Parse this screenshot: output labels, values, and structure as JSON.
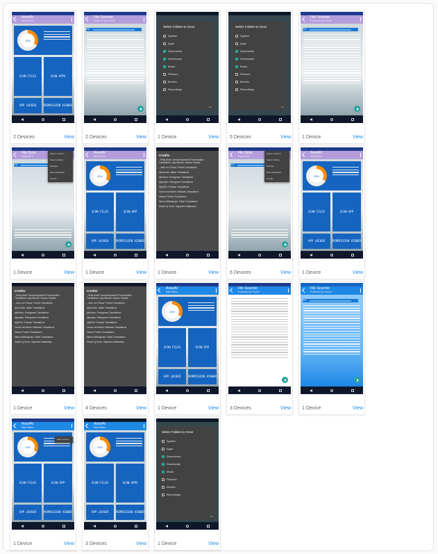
{
  "devices": [
    {
      "kind": "main",
      "count": "2 Devices",
      "view": "View",
      "title": "AssoAV",
      "subtitle": "Main Menu",
      "pct": "33%",
      "btn1": "SCAN FILES",
      "btn2": "SCAN APPS",
      "btn3": "APP LOCKER",
      "btn4": "PERMISSION VIEWER"
    },
    {
      "kind": "scanner",
      "count": "2 Devices",
      "view": "View",
      "title": "File Scanner",
      "subtitle": "Powered by Foxxire",
      "pct": "0%"
    },
    {
      "kind": "folders",
      "count": "1 Device",
      "view": "View"
    },
    {
      "kind": "folders-dim",
      "count": "5 Devices",
      "view": "View"
    },
    {
      "kind": "scanner",
      "count": "1 Device",
      "view": "View",
      "title": "File Scanner",
      "subtitle": "Powered by Foxxire",
      "pct": "0%"
    },
    {
      "kind": "scanner-menu",
      "count": "1 Device",
      "view": "View",
      "title": "File Scan",
      "subtitle": "Powered b",
      "pct": "0%"
    },
    {
      "kind": "main",
      "count": "1 Device",
      "view": "View",
      "title": "AssoAV",
      "subtitle": "Main Menu",
      "pct": "33%",
      "btn1": "SCAN FILES",
      "btn2": "SCAN APP",
      "btn3": "APP LOCKER",
      "btn4": "PERMISSION VIEWER"
    },
    {
      "kind": "credits",
      "count": "1 Device",
      "view": "View"
    },
    {
      "kind": "scanner-menu",
      "count": "6 Devices",
      "view": "View",
      "title": "File Scan",
      "subtitle": "Powered b",
      "pct": "0%"
    },
    {
      "kind": "main",
      "count": "1 Device",
      "view": "View",
      "title": "AssoAV",
      "subtitle": "Main Menu",
      "pct": "33%",
      "btn1": "SCAN FILES",
      "btn2": "SCAN APP",
      "btn3": "APP LOCKER",
      "btn4": "PERMISSION VIEWER"
    },
    {
      "kind": "credits",
      "count": "1 Device",
      "view": "View"
    },
    {
      "kind": "credits",
      "count": "4 Devices",
      "view": "View"
    },
    {
      "kind": "main-blue",
      "count": "1 Device",
      "view": "View",
      "title": "AssoAV",
      "subtitle": "Main Menu",
      "pct": "33%",
      "btn1": "SCAN FILES",
      "btn2": "SCAN APP",
      "btn3": "APP LOCKER",
      "btn4": "PERMISSION VIEWER"
    },
    {
      "kind": "scanner-white",
      "count": "3 Devices",
      "view": "View",
      "title": "File Scanner",
      "subtitle": "Powered by Foxxire",
      "pct": ""
    },
    {
      "kind": "scanner-blue",
      "count": "1 Device",
      "view": "View",
      "title": "File Scanner",
      "subtitle": "Powered by Foxxire",
      "pct": "0%"
    },
    {
      "kind": "main-menu",
      "count": "1 Device",
      "view": "View",
      "title": "AssoAV",
      "subtitle": "Main Menu",
      "pct": "33%",
      "btn1": "SCAN FILES",
      "btn2": "SCAN APP",
      "btn3": "APP LOCKER",
      "btn4": "PERMISSION VIEWER"
    },
    {
      "kind": "main-dark",
      "count": "3 Devices",
      "view": "View",
      "title": "AssoAV",
      "subtitle": "Main Menu",
      "pct": "33%",
      "btn1": "SCAN FILES",
      "btn2": "SCAN APPS",
      "btn3": "APP LOCKER",
      "btn4": "PERMISSION VIEWER"
    },
    {
      "kind": "folders-full",
      "count": "1 Device",
      "view": "View"
    }
  ],
  "folders": {
    "title": "Select Folders to Scan",
    "items": [
      {
        "label": "System",
        "checked": false
      },
      {
        "label": "Apps",
        "checked": false
      },
      {
        "label": "Documents",
        "checked": true
      },
      {
        "label": "Downloads",
        "checked": true
      },
      {
        "label": "Music",
        "checked": true
      },
      {
        "label": "Pictures",
        "checked": false
      },
      {
        "label": "Movies",
        "checked": false
      },
      {
        "label": "Recordings",
        "checked": false
      }
    ],
    "ok": "OK"
  },
  "credits": {
    "title": "Credits",
    "items": [
      "- Petty Moelt: German/Spanish/ French/Italian Translations, App Banner, Various Tweaks",
      "- Jean Luc Tibaux: French Translations",
      "@occoriss: Italian Translations",
      "@d4ncor: Portuguese Translations",
      "@jomato: Portuguese Translations",
      "@g3311: Russian Translations",
      "Gravel van Bekel: Afrikaans Translations",
      "tuohas: Finnish Translations",
      "Marcin Mikolajczak: Polish Translations",
      "Daniel by Cisco: Signature Databases"
    ]
  },
  "menu": {
    "items": [
      "Select Location",
      "Select Folders",
      "Settings",
      "Send Feedback",
      "Credits"
    ],
    "main_item": "More options"
  }
}
